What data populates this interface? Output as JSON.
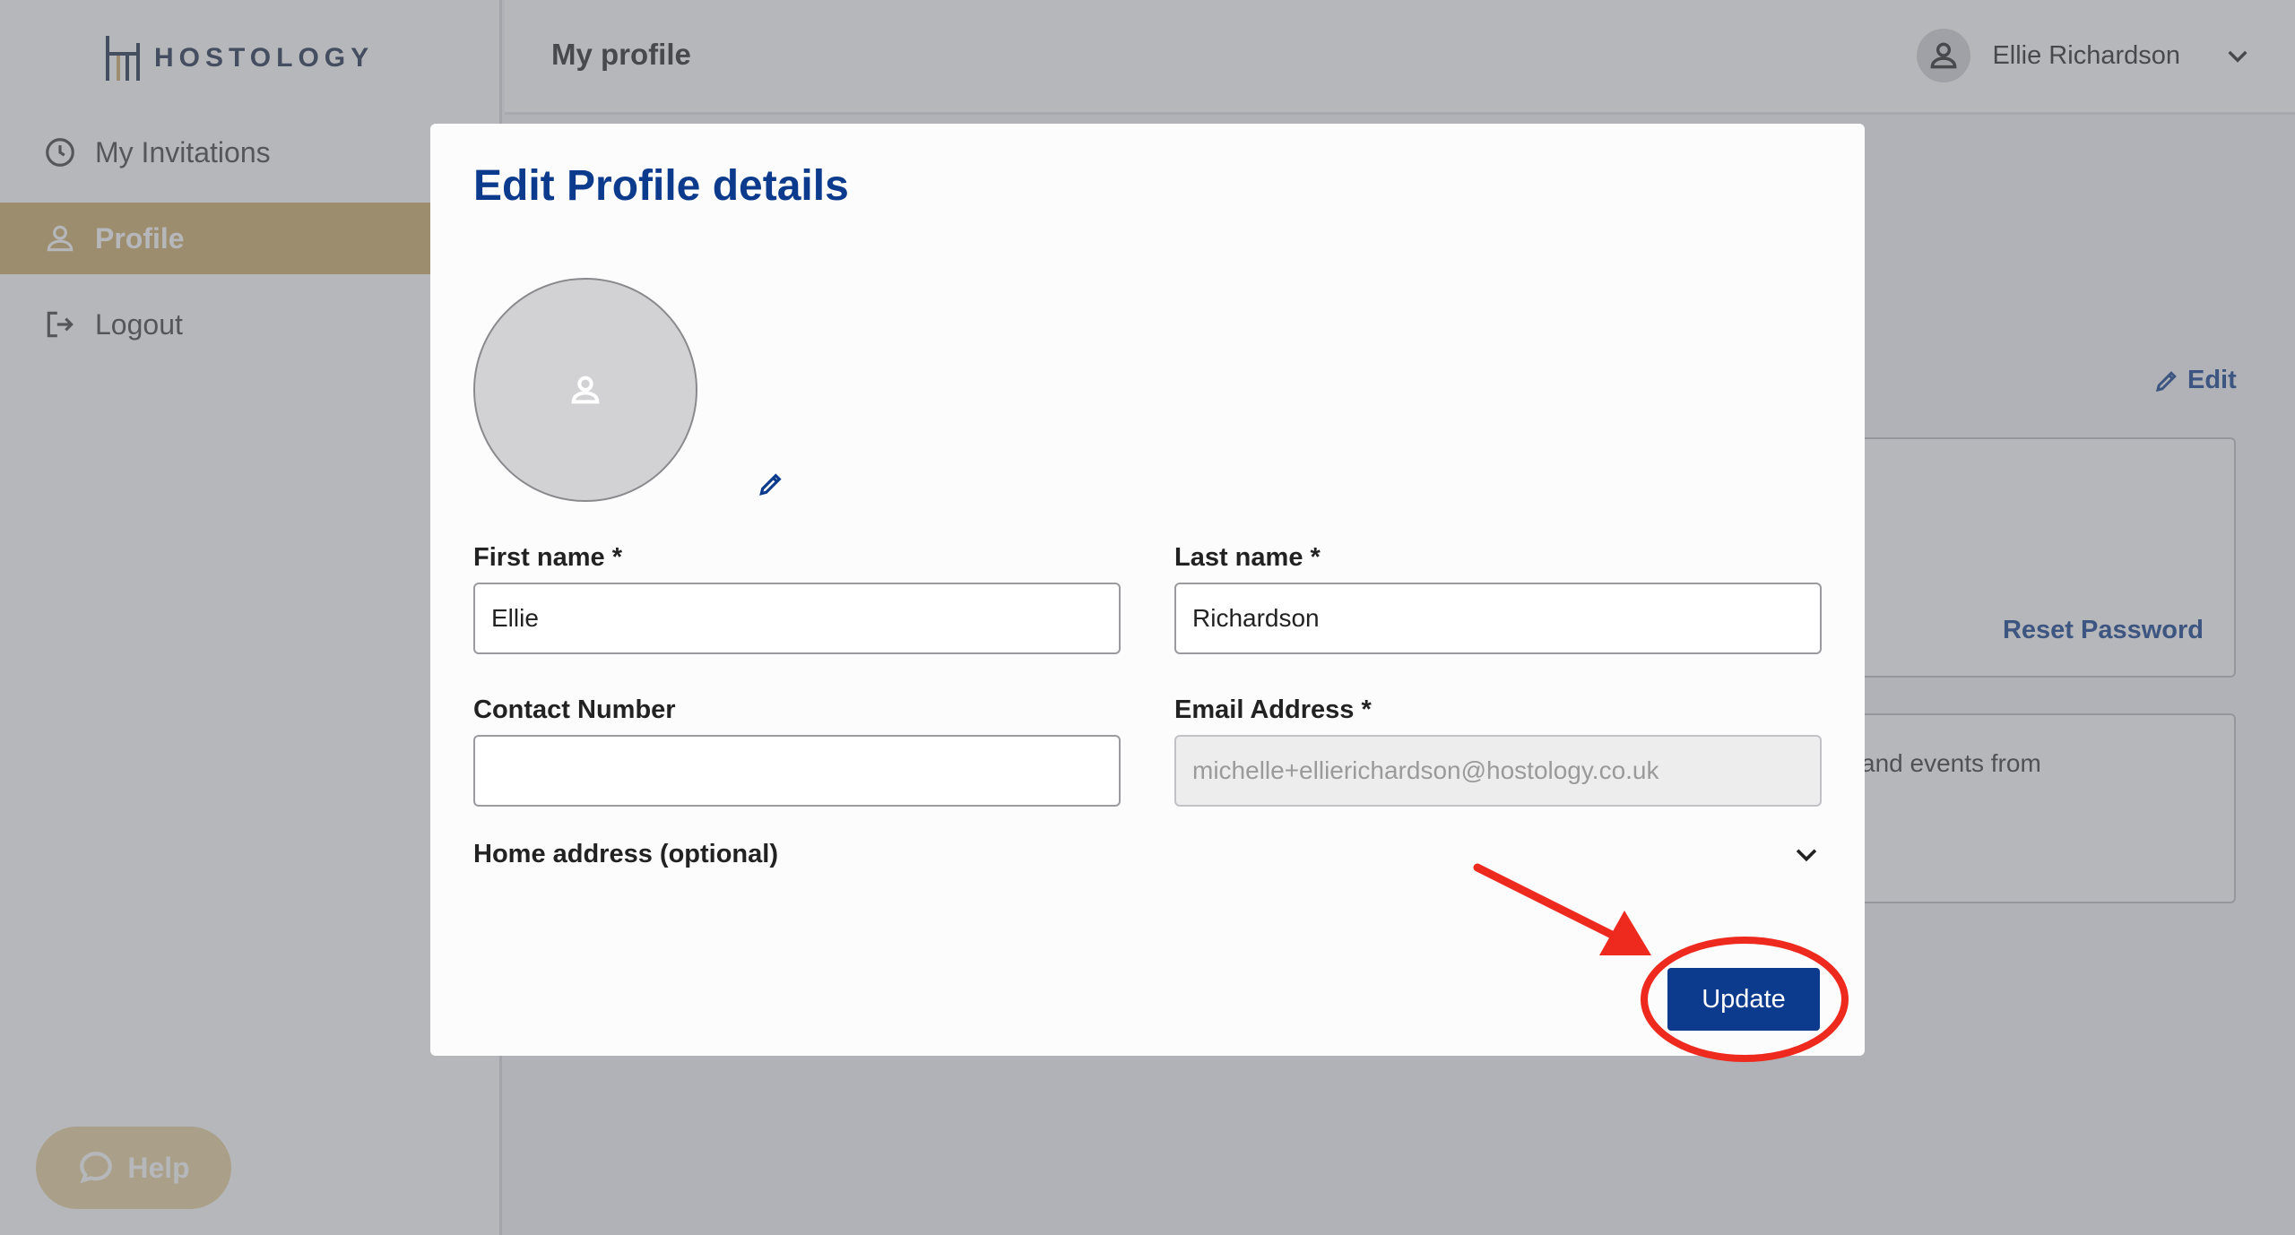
{
  "brand": {
    "name": "HOSTOLOGY",
    "accent": "#c9ab66",
    "primary": "#0c3a8c"
  },
  "sidebar": {
    "items": [
      {
        "label": "My Invitations",
        "icon": "clock-icon"
      },
      {
        "label": "Profile",
        "icon": "user-icon",
        "active": true
      },
      {
        "label": "Logout",
        "icon": "logout-icon"
      }
    ],
    "help_label": "Help"
  },
  "header": {
    "title": "My profile",
    "user_name": "Ellie Richardson"
  },
  "background": {
    "edit_label": "Edit",
    "reset_password_label": "Reset Password",
    "card_text": "and events from"
  },
  "modal": {
    "title": "Edit Profile details",
    "first_name": {
      "label": "First name *",
      "value": "Ellie"
    },
    "last_name": {
      "label": "Last name *",
      "value": "Richardson"
    },
    "contact_number": {
      "label": "Contact Number",
      "value": ""
    },
    "email": {
      "label": "Email Address *",
      "value": "michelle+ellierichardson@hostology.co.uk"
    },
    "home_address_label": "Home address (optional)",
    "update_label": "Update"
  },
  "annotation": {
    "color": "#ee2a1e"
  }
}
